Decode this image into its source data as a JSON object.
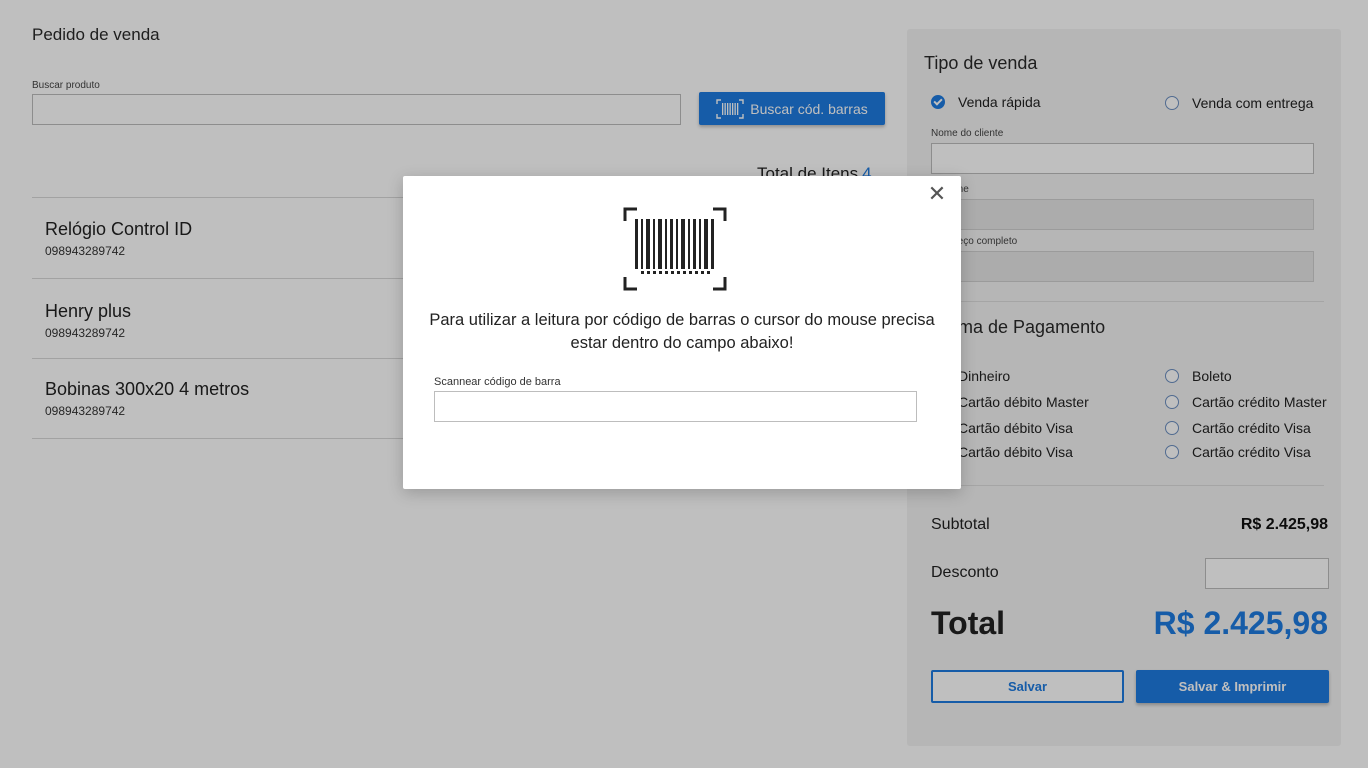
{
  "header": {
    "title": "Pedido de venda"
  },
  "search": {
    "label": "Buscar produto",
    "value": "",
    "barcode_button_label": "Buscar cód. barras"
  },
  "summary": {
    "total_items_label": "Total de Itens",
    "total_items_count": "4"
  },
  "items": [
    {
      "name": "Relógio Control ID",
      "code": "098943289742"
    },
    {
      "name": "Henry plus",
      "code": "098943289742"
    },
    {
      "name": "Bobinas 300x20 4 metros",
      "code": "098943289742"
    }
  ],
  "sale_panel": {
    "title": "Tipo de venda",
    "sale_types": [
      {
        "label": "Venda rápida",
        "checked": true
      },
      {
        "label": "Venda com entrega",
        "checked": false
      }
    ],
    "fields": [
      {
        "label": "Nome do cliente",
        "value": "",
        "disabled": false
      },
      {
        "label": "Telefone",
        "value": "",
        "disabled": true
      },
      {
        "label": "Endereço completo",
        "value": "",
        "disabled": true
      }
    ],
    "payment_title": "Forma de Pagamento",
    "payment_methods": [
      {
        "label": "Dinheiro",
        "checked": false
      },
      {
        "label": "Boleto",
        "checked": false
      },
      {
        "label": "Cartão débito Master",
        "checked": false
      },
      {
        "label": "Cartão crédito Master",
        "checked": false
      },
      {
        "label": "Cartão débito Visa",
        "checked": false
      },
      {
        "label": "Cartão crédito Visa",
        "checked": false
      },
      {
        "label": "Cartão débito Visa",
        "checked": false
      },
      {
        "label": "Cartão crédito Visa",
        "checked": false
      }
    ],
    "subtotal_label": "Subtotal",
    "subtotal_value": "R$ 2.425,98",
    "discount_label": "Desconto",
    "discount_value": "",
    "total_label": "Total",
    "total_value": "R$ 2.425,98",
    "save_label": "Salvar",
    "save_print_label": "Salvar & Imprimir"
  },
  "modal": {
    "message": "Para utilizar a leitura por código de barras o cursor do mouse precisa estar dentro do campo abaixo!",
    "input_label": "Scannear código de barra",
    "input_value": "",
    "close_icon": "close-icon",
    "barcode_icon": "barcode-scan-icon"
  },
  "colors": {
    "accent": "#1e7be0",
    "overlay": "rgba(0,0,0,0.25)"
  }
}
